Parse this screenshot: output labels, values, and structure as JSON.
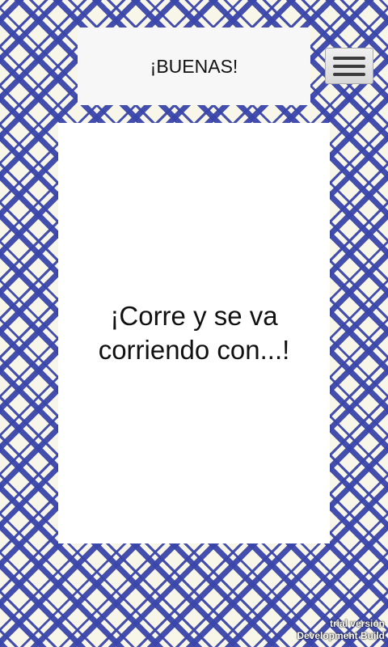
{
  "header": {
    "title": "¡BUENAS!"
  },
  "menu_button": {
    "icon": "hamburger-menu-icon"
  },
  "card": {
    "text": "¡Corre y se va corriendo con...!"
  },
  "watermark": {
    "line1": "trial version",
    "line2": "Development Build"
  },
  "colors": {
    "pattern_blue": "#3a46aa",
    "pattern_background": "#f8f6e8",
    "header_background": "#f7f7f7",
    "card_background": "#ffffff"
  }
}
